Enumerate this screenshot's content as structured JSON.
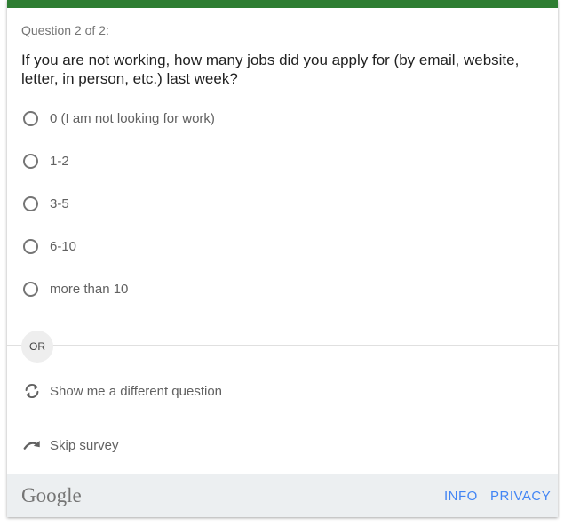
{
  "survey": {
    "progress": "Question 2 of 2:",
    "question": "If you are not working, how many jobs did you apply for (by email, website, letter, in person, etc.) last week?",
    "options": [
      {
        "label": "0 (I am not looking for work)",
        "selected": false
      },
      {
        "label": "1-2",
        "selected": false
      },
      {
        "label": "3-5",
        "selected": false
      },
      {
        "label": "6-10",
        "selected": false
      },
      {
        "label": "more than 10",
        "selected": false
      }
    ],
    "or_label": "OR",
    "actions": [
      {
        "label": "Show me a different question",
        "icon": "refresh-icon"
      },
      {
        "label": "Skip survey",
        "icon": "skip-arrow-icon"
      }
    ]
  },
  "footer": {
    "logo": "Google",
    "info_label": "INFO",
    "privacy_label": "PRIVACY"
  },
  "colors": {
    "accent_bar": "#2e7d32",
    "link": "#4285f4",
    "footer_bg": "#eceff1"
  }
}
